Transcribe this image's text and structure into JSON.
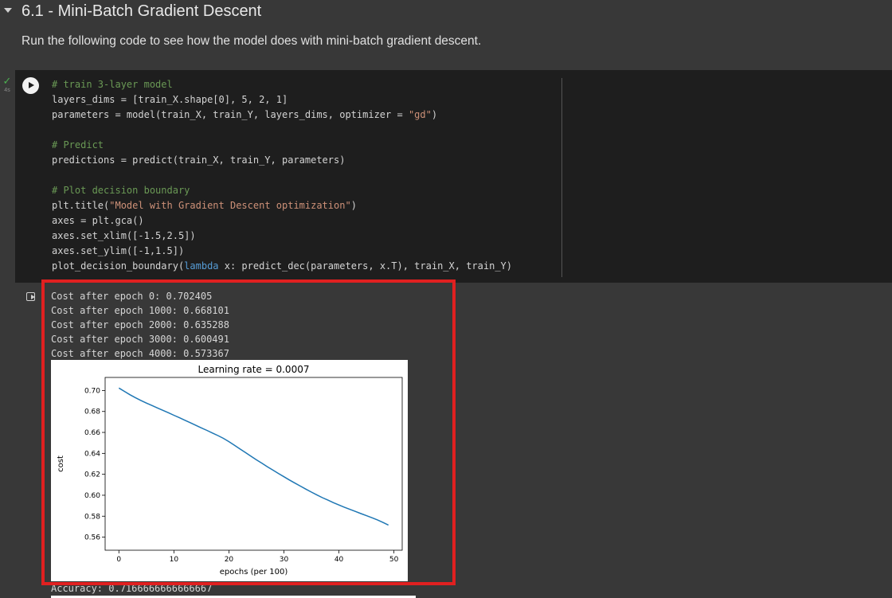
{
  "section": {
    "title": "6.1 - Mini-Batch Gradient Descent",
    "description": "Run the following code to see how the model does with mini-batch gradient descent."
  },
  "cell": {
    "run_time": "4s",
    "code_lines": [
      [
        {
          "t": "# train 3-layer model",
          "c": "cm"
        }
      ],
      [
        {
          "t": "layers_dims = [train_X.shape[0], 5, 2, 1]"
        }
      ],
      [
        {
          "t": "parameters = model(train_X, train_Y, layers_dims, optimizer = "
        },
        {
          "t": "\"gd\"",
          "c": "st"
        },
        {
          "t": ")"
        }
      ],
      [],
      [
        {
          "t": "# Predict",
          "c": "cm"
        }
      ],
      [
        {
          "t": "predictions = predict(train_X, train_Y, parameters)"
        }
      ],
      [],
      [
        {
          "t": "# Plot decision boundary",
          "c": "cm"
        }
      ],
      [
        {
          "t": "plt.title("
        },
        {
          "t": "\"Model with Gradient Descent optimization\"",
          "c": "st"
        },
        {
          "t": ")"
        }
      ],
      [
        {
          "t": "axes = plt.gca()"
        }
      ],
      [
        {
          "t": "axes.set_xlim([-1.5,2.5])"
        }
      ],
      [
        {
          "t": "axes.set_ylim([-1,1.5])"
        }
      ],
      [
        {
          "t": "plot_decision_boundary("
        },
        {
          "t": "lambda",
          "c": "kw"
        },
        {
          "t": " x: predict_dec(parameters, x.T), train_X, train_Y)"
        }
      ]
    ]
  },
  "output": {
    "lines": [
      "Cost after epoch 0: 0.702405",
      "Cost after epoch 1000: 0.668101",
      "Cost after epoch 2000: 0.635288",
      "Cost after epoch 3000: 0.600491",
      "Cost after epoch 4000: 0.573367"
    ],
    "accuracy": "Accuracy: 0.7166666666666667"
  },
  "colors": {
    "highlight": "#e02020",
    "line": "#1f77b4"
  },
  "chart_data": {
    "type": "line",
    "title": "Learning rate = 0.0007",
    "xlabel": "epochs (per 100)",
    "ylabel": "cost",
    "xlim": [
      -2.5,
      51.5
    ],
    "ylim": [
      0.5475,
      0.7125
    ],
    "xticks": [
      0,
      10,
      20,
      30,
      40,
      50
    ],
    "yticks": [
      0.56,
      0.58,
      0.6,
      0.62,
      0.64,
      0.66,
      0.68,
      0.7
    ],
    "ytick_labels": [
      "0.56",
      "0.58",
      "0.60",
      "0.62",
      "0.64",
      "0.66",
      "0.68",
      "0.70"
    ],
    "grid": false,
    "series": [
      {
        "x": [
          0,
          1,
          2,
          3,
          4,
          5,
          6,
          7,
          8,
          9,
          10,
          11,
          12,
          13,
          14,
          15,
          16,
          17,
          18,
          19,
          20,
          21,
          22,
          23,
          24,
          25,
          26,
          27,
          28,
          29,
          30,
          31,
          32,
          33,
          34,
          35,
          36,
          37,
          38,
          39,
          40,
          41,
          42,
          43,
          44,
          45,
          46,
          47,
          48,
          49
        ],
        "values": [
          0.7024,
          0.6992,
          0.696,
          0.6932,
          0.6905,
          0.688,
          0.6857,
          0.6834,
          0.6811,
          0.6788,
          0.6764,
          0.674,
          0.6716,
          0.6692,
          0.6667,
          0.6643,
          0.6619,
          0.6594,
          0.657,
          0.6543,
          0.6512,
          0.6478,
          0.6443,
          0.6408,
          0.6373,
          0.6338,
          0.6305,
          0.6272,
          0.624,
          0.6208,
          0.6177,
          0.6146,
          0.6116,
          0.6087,
          0.6058,
          0.603,
          0.6003,
          0.5977,
          0.5953,
          0.5929,
          0.5907,
          0.5885,
          0.5865,
          0.5845,
          0.5825,
          0.5805,
          0.5785,
          0.5765,
          0.574,
          0.5715
        ]
      }
    ]
  }
}
